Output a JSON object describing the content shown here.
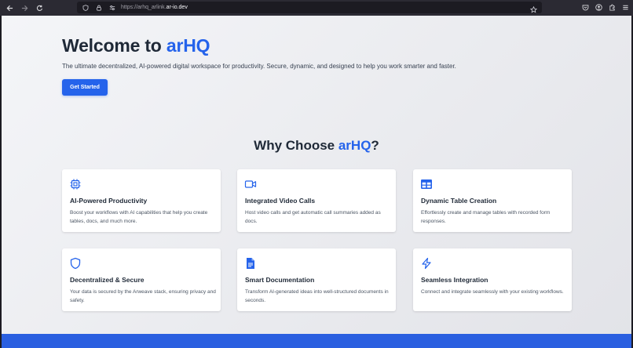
{
  "browser": {
    "url_prefix": "https://arhq_arlink.",
    "url_domain": "ar-io.dev"
  },
  "hero": {
    "title_main": "Welcome to ",
    "title_accent": "arHQ",
    "subtitle": "The ultimate decentralized, AI-powered digital workspace for productivity. Secure, dynamic, and designed to help you work smarter and faster.",
    "cta_label": "Get Started"
  },
  "why": {
    "title_main": "Why Choose ",
    "title_accent": "arHQ",
    "title_end": "?"
  },
  "features": [
    {
      "icon": "cpu-icon",
      "title": "AI-Powered Productivity",
      "desc": "Boost your workflows with AI capabilities that help you create tables, docs, and much more."
    },
    {
      "icon": "video-camera-icon",
      "title": "Integrated Video Calls",
      "desc": "Host video calls and get automatic call summaries added as docs."
    },
    {
      "icon": "table-icon",
      "title": "Dynamic Table Creation",
      "desc": "Effortlessly create and manage tables with recorded form responses."
    },
    {
      "icon": "shield-icon",
      "title": "Decentralized & Secure",
      "desc": "Your data is secured by the Arweave stack, ensuring privacy and safety."
    },
    {
      "icon": "document-icon",
      "title": "Smart Documentation",
      "desc": "Transform AI-generated ideas into well-structured documents in seconds."
    },
    {
      "icon": "lightning-icon",
      "title": "Seamless Integration",
      "desc": "Connect and integrate seamlessly with your existing workflows."
    }
  ],
  "colors": {
    "accent": "#2563eb",
    "footer": "#2a5fe0",
    "chrome": "#2b2a33"
  }
}
